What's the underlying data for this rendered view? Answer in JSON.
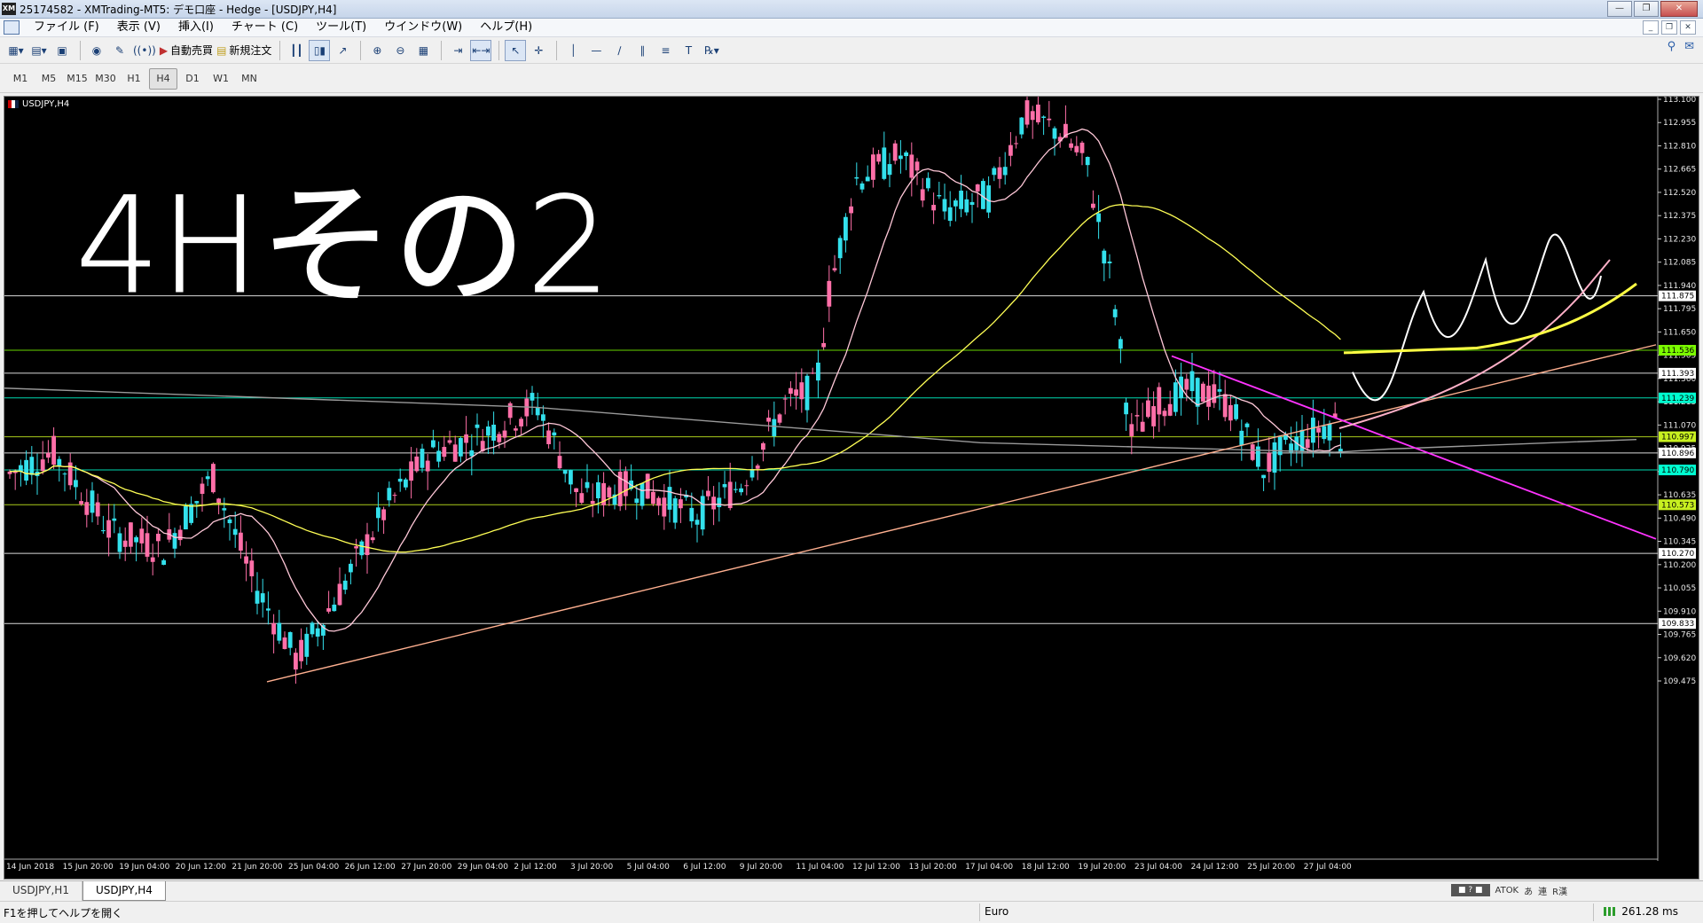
{
  "window": {
    "title": "25174582 - XMTrading-MT5: デモ口座 - Hedge - [USDJPY,H4]",
    "logo_text": "XM"
  },
  "menu": [
    "ファイル (F)",
    "表示 (V)",
    "挿入(I)",
    "チャート (C)",
    "ツール(T)",
    "ウインドウ(W)",
    "ヘルプ(H)"
  ],
  "toolbar": {
    "auto_trade": "自動売買",
    "new_order": "新規注文"
  },
  "timeframes": [
    "M1",
    "M5",
    "M15",
    "M30",
    "H1",
    "H4",
    "D1",
    "W1",
    "MN"
  ],
  "active_timeframe": "H4",
  "chart": {
    "symbol_label": "USDJPY,H4",
    "annotation_text": "4Hその2",
    "price_ticks": [
      "113.100",
      "112.955",
      "112.810",
      "112.665",
      "112.520",
      "112.375",
      "112.230",
      "112.085",
      "111.940",
      "111.795",
      "111.650",
      "111.505",
      "111.360",
      "111.215",
      "111.070",
      "110.925",
      "110.780",
      "110.635",
      "110.490",
      "110.345",
      "110.200",
      "110.055",
      "109.910",
      "109.765",
      "109.620",
      "109.475"
    ],
    "level_labels": [
      {
        "price": "111.875",
        "color": "#ffffff"
      },
      {
        "price": "111.536",
        "color": "#7cfc00"
      },
      {
        "price": "111.393",
        "color": "#ffffff"
      },
      {
        "price": "111.239",
        "color": "#00ffd0"
      },
      {
        "price": "110.997",
        "color": "#c8f020"
      },
      {
        "price": "110.896",
        "color": "#ffffff"
      },
      {
        "price": "110.790",
        "color": "#00ffd0"
      },
      {
        "price": "110.573",
        "color": "#c8f020"
      },
      {
        "price": "110.270",
        "color": "#ffffff"
      },
      {
        "price": "109.833",
        "color": "#ffffff"
      }
    ],
    "time_labels": [
      "14 Jun 2018",
      "15 Jun 20:00",
      "19 Jun 04:00",
      "20 Jun 12:00",
      "21 Jun 20:00",
      "25 Jun 04:00",
      "26 Jun 12:00",
      "27 Jun 20:00",
      "29 Jun 04:00",
      "2 Jul 12:00",
      "3 Jul 20:00",
      "5 Jul 04:00",
      "6 Jul 12:00",
      "9 Jul 20:00",
      "11 Jul 04:00",
      "12 Jul 12:00",
      "13 Jul 20:00",
      "17 Jul 04:00",
      "18 Jul 12:00",
      "19 Jul 20:00",
      "23 Jul 04:00",
      "24 Jul 12:00",
      "25 Jul 20:00",
      "27 Jul 04:00"
    ],
    "colors": {
      "bull": "#ff6fa8",
      "bear": "#33e0ec",
      "bg": "#000000",
      "ma_fast": "#ffc8d8",
      "ma_slow": "#ffff55",
      "trend_up": "#ffb090",
      "trend_down": "#ff33ff"
    }
  },
  "tabs": [
    "USDJPY,H1",
    "USDJPY,H4"
  ],
  "active_tab": "USDJPY,H4",
  "status": {
    "help": "F1を押してヘルプを開く",
    "profile": "Euro",
    "ping": "261.28 ms",
    "ime": [
      "ATOK",
      "あ",
      "連",
      "R漢"
    ]
  }
}
